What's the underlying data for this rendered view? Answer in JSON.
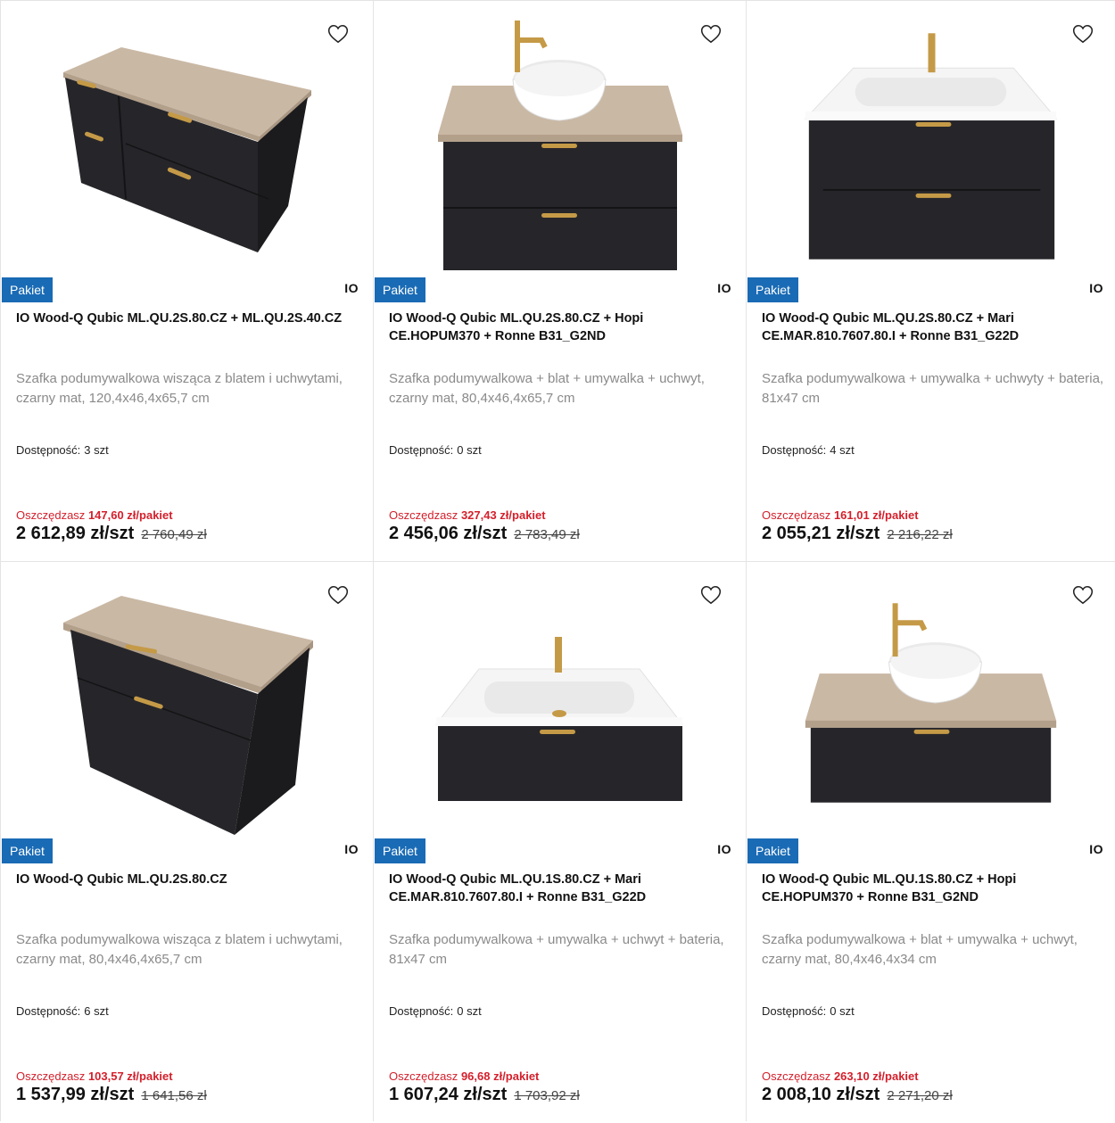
{
  "products": [
    {
      "badge": "Pakiet",
      "brand": "IO",
      "title": "IO Wood-Q Qubic ML.QU.2S.80.CZ + ML.QU.2S.40.CZ",
      "description": "Szafka podumywalkowa wisząca z blatem i uchwytami, czarny mat, 120,4x46,4x65,7 cm",
      "availability_label": "Dostępność:",
      "availability_value": "3 szt",
      "savings_label": "Oszczędzasz",
      "savings_value": "147,60 zł/pakiet",
      "price": "2 612,89 zł/szt",
      "old_price": "2 760,49 zł",
      "image": "vanity-wide"
    },
    {
      "badge": "Pakiet",
      "brand": "IO",
      "title": "IO Wood-Q Qubic ML.QU.2S.80.CZ + Hopi CE.HOPUM370 + Ronne B31_G2ND",
      "description": "Szafka podumywalkowa + blat + umywalka + uchwyt, czarny mat, 80,4x46,4x65,7 cm",
      "availability_label": "Dostępność:",
      "availability_value": "0 szt",
      "savings_label": "Oszczędzasz",
      "savings_value": "327,43 zł/pakiet",
      "price": "2 456,06 zł/szt",
      "old_price": "2 783,49 zł",
      "image": "vanity-bowl-2drawer"
    },
    {
      "badge": "Pakiet",
      "brand": "IO",
      "title": "IO Wood-Q Qubic ML.QU.2S.80.CZ + Mari CE.MAR.810.7607.80.I + Ronne B31_G22D",
      "description": "Szafka podumywalkowa + umywalka + uchwyty + bateria, 81x47 cm",
      "availability_label": "Dostępność:",
      "availability_value": "4 szt",
      "savings_label": "Oszczędzasz",
      "savings_value": "161,01 zł/pakiet",
      "price": "2 055,21 zł/szt",
      "old_price": "2 216,22 zł",
      "image": "vanity-basin-2drawer"
    },
    {
      "badge": "Pakiet",
      "brand": "IO",
      "title": "IO Wood-Q Qubic ML.QU.2S.80.CZ",
      "description": "Szafka podumywalkowa wisząca z blatem i uchwytami, czarny mat, 80,4x46,4x65,7 cm",
      "availability_label": "Dostępność:",
      "availability_value": "6 szt",
      "savings_label": "Oszczędzasz",
      "savings_value": "103,57 zł/pakiet",
      "price": "1 537,99 zł/szt",
      "old_price": "1 641,56 zł",
      "image": "vanity-angled"
    },
    {
      "badge": "Pakiet",
      "brand": "IO",
      "title": "IO Wood-Q Qubic ML.QU.1S.80.CZ + Mari CE.MAR.810.7607.80.I + Ronne B31_G22D",
      "description": "Szafka podumywalkowa + umywalka + uchwyt + bateria, 81x47 cm",
      "availability_label": "Dostępność:",
      "availability_value": "0 szt",
      "savings_label": "Oszczędzasz",
      "savings_value": "96,68 zł/pakiet",
      "price": "1 607,24 zł/szt",
      "old_price": "1 703,92 zł",
      "image": "vanity-basin-1drawer"
    },
    {
      "badge": "Pakiet",
      "brand": "IO",
      "title": "IO Wood-Q Qubic ML.QU.1S.80.CZ + Hopi CE.HOPUM370 + Ronne B31_G2ND",
      "description": "Szafka podumywalkowa + blat + umywalka + uchwyt, czarny mat, 80,4x46,4x34 cm",
      "availability_label": "Dostępność:",
      "availability_value": "0 szt",
      "savings_label": "Oszczędzasz",
      "savings_value": "263,10 zł/pakiet",
      "price": "2 008,10 zł/szt",
      "old_price": "2 271,20 zł",
      "image": "vanity-bowl-1drawer"
    }
  ],
  "colors": {
    "badge": "#1a6bb5",
    "savings": "#d4202c",
    "cabinet": "#26262a",
    "wood": "#c9b8a4",
    "gold": "#c59a47"
  },
  "icons": {
    "favorite": "heart-outline-icon"
  }
}
